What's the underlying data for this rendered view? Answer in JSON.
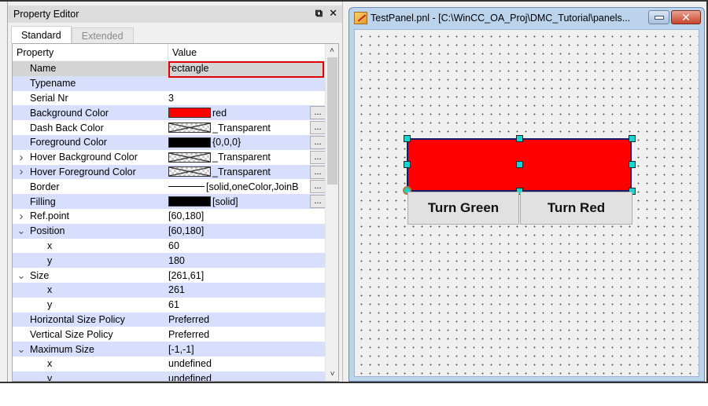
{
  "property_editor": {
    "title": "Property Editor",
    "float_icon": "⧉",
    "close_icon": "✕",
    "tabs": [
      {
        "label": "Standard",
        "active": true
      },
      {
        "label": "Extended",
        "active": false
      }
    ],
    "columns": {
      "property": "Property",
      "value": "Value"
    },
    "rows": [
      {
        "name": "Name",
        "value": "rectangle",
        "expander": "",
        "child": false,
        "swatch": null,
        "button": false
      },
      {
        "name": "Typename",
        "value": "",
        "expander": "",
        "child": false,
        "swatch": null,
        "button": false
      },
      {
        "name": "Serial Nr",
        "value": "3",
        "expander": "",
        "child": false,
        "swatch": null,
        "button": false
      },
      {
        "name": "Background Color",
        "value": "red",
        "expander": "",
        "child": false,
        "swatch": "#ff0000",
        "button": true
      },
      {
        "name": "Dash Back Color",
        "value": "_Transparent",
        "expander": "",
        "child": false,
        "swatch": "transparent",
        "button": true
      },
      {
        "name": "Foreground Color",
        "value": "{0,0,0}",
        "expander": "",
        "child": false,
        "swatch": "#000000",
        "button": true
      },
      {
        "name": "Hover Background Color",
        "value": "_Transparent",
        "expander": ">",
        "child": false,
        "swatch": "transparent",
        "button": true
      },
      {
        "name": "Hover Foreground Color",
        "value": "_Transparent",
        "expander": ">",
        "child": false,
        "swatch": "transparent",
        "button": true
      },
      {
        "name": "Border",
        "value": "[solid,oneColor,JoinB",
        "expander": "",
        "child": false,
        "swatch": "line",
        "button": true
      },
      {
        "name": "Filling",
        "value": "[solid]",
        "expander": "",
        "child": false,
        "swatch": "#000000",
        "button": true
      },
      {
        "name": "Ref.point",
        "value": "[60,180]",
        "expander": ">",
        "child": false,
        "swatch": null,
        "button": false
      },
      {
        "name": "Position",
        "value": "[60,180]",
        "expander": "v",
        "child": false,
        "swatch": null,
        "button": false
      },
      {
        "name": "x",
        "value": "60",
        "expander": "",
        "child": true,
        "swatch": null,
        "button": false
      },
      {
        "name": "y",
        "value": "180",
        "expander": "",
        "child": true,
        "swatch": null,
        "button": false
      },
      {
        "name": "Size",
        "value": "[261,61]",
        "expander": "v",
        "child": false,
        "swatch": null,
        "button": false
      },
      {
        "name": "x",
        "value": "261",
        "expander": "",
        "child": true,
        "swatch": null,
        "button": false
      },
      {
        "name": "y",
        "value": "61",
        "expander": "",
        "child": true,
        "swatch": null,
        "button": false
      },
      {
        "name": "Horizontal Size Policy",
        "value": "Preferred",
        "expander": "",
        "child": false,
        "swatch": null,
        "button": false
      },
      {
        "name": "Vertical Size Policy",
        "value": "Preferred",
        "expander": "",
        "child": false,
        "swatch": null,
        "button": false
      },
      {
        "name": "Maximum Size",
        "value": "[-1,-1]",
        "expander": "v",
        "child": false,
        "swatch": null,
        "button": false
      },
      {
        "name": "x",
        "value": "undefined",
        "expander": "",
        "child": true,
        "swatch": null,
        "button": false
      },
      {
        "name": "y",
        "value": "undefined",
        "expander": "",
        "child": true,
        "swatch": null,
        "button": false
      }
    ],
    "button_label": "...",
    "scroll_up": "▲",
    "scroll_down": "▼"
  },
  "panel_window": {
    "title": "TestPanel.pnl - [C:\\WinCC_OA_Proj\\DMC_Tutorial\\panels...",
    "close_label": "✕",
    "rectangle_color": "#ff0000",
    "buttons": [
      {
        "label": "Turn Green"
      },
      {
        "label": "Turn Red"
      }
    ]
  }
}
